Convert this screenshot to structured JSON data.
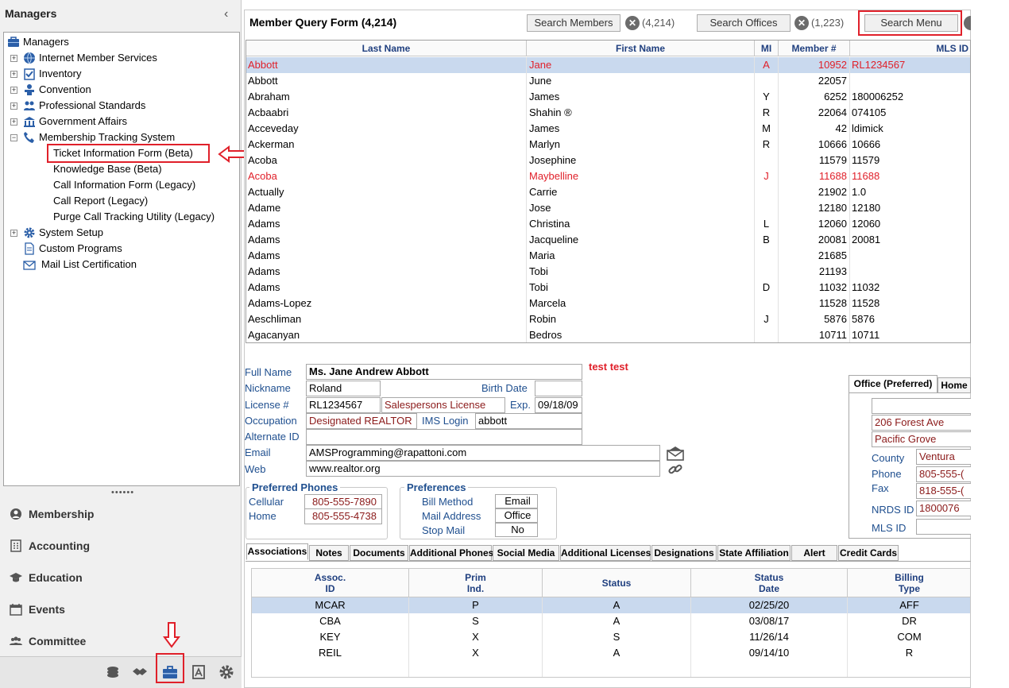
{
  "sidebar": {
    "title": "Managers",
    "tree": [
      {
        "label": "Managers",
        "icon": "briefcase-icon"
      },
      {
        "label": "Internet Member Services",
        "icon": "globe-icon"
      },
      {
        "label": "Inventory",
        "icon": "checklist-icon"
      },
      {
        "label": "Convention",
        "icon": "podium-icon"
      },
      {
        "label": "Professional Standards",
        "icon": "people-icon"
      },
      {
        "label": "Government Affairs",
        "icon": "building-icon"
      },
      {
        "label": "Membership Tracking System",
        "icon": "phone-icon"
      },
      {
        "label": "Ticket Information Form (Beta)"
      },
      {
        "label": "Knowledge Base (Beta)"
      },
      {
        "label": "Call Information Form (Legacy)"
      },
      {
        "label": "Call Report (Legacy)"
      },
      {
        "label": "Purge Call Tracking Utility (Legacy)"
      },
      {
        "label": "System Setup",
        "icon": "gear-icon"
      },
      {
        "label": "Custom Programs",
        "icon": "document-icon"
      },
      {
        "label": "Mail List Certification",
        "icon": "envelope-icon"
      }
    ],
    "nav_sections": [
      {
        "label": "Membership",
        "icon": "membership-icon"
      },
      {
        "label": "Accounting",
        "icon": "calculator-icon"
      },
      {
        "label": "Education",
        "icon": "graduation-cap-icon"
      },
      {
        "label": "Events",
        "icon": "calendar-icon"
      },
      {
        "label": "Committee",
        "icon": "group-icon"
      }
    ]
  },
  "header": {
    "form_title": "Member Query Form (4,214)",
    "search_members_label": "Search Members",
    "members_count": "(4,214)",
    "search_offices_label": "Search Offices",
    "offices_count": "(1,223)",
    "search_menu_label": "Search Menu"
  },
  "grid": {
    "columns": [
      "Last Name",
      "First Name",
      "MI",
      "Member #",
      "MLS ID"
    ],
    "rows": [
      [
        "Abbott",
        "Jane",
        "A",
        "10952",
        "RL1234567"
      ],
      [
        "Abbott",
        "June",
        "",
        "22057",
        ""
      ],
      [
        "Abraham",
        "James",
        "Y",
        "6252",
        "180006252"
      ],
      [
        "Acbaabri",
        "Shahin ®",
        "R",
        "22064",
        "074105"
      ],
      [
        "Acceveday",
        "James",
        "M",
        "42",
        "ldimick"
      ],
      [
        "Ackerman",
        "Marlyn",
        "R",
        "10666",
        "10666"
      ],
      [
        "Acoba",
        "Josephine",
        "",
        "11579",
        "11579"
      ],
      [
        "Acoba",
        "Maybelline",
        "J",
        "11688",
        "11688"
      ],
      [
        "Actually",
        "Carrie",
        "",
        "21902",
        "1.0"
      ],
      [
        "Adame",
        "Jose",
        "",
        "12180",
        "12180"
      ],
      [
        "Adams",
        "Christina",
        "L",
        "12060",
        "12060"
      ],
      [
        "Adams",
        "Jacqueline",
        "B",
        "20081",
        "20081"
      ],
      [
        "Adams",
        "Maria",
        "",
        "21685",
        ""
      ],
      [
        "Adams",
        "Tobi",
        "",
        "21193",
        ""
      ],
      [
        "Adams",
        "Tobi",
        "D",
        "11032",
        "11032"
      ],
      [
        "Adams-Lopez",
        "Marcela",
        "",
        "11528",
        "11528"
      ],
      [
        "Aeschliman",
        "Robin",
        "J",
        "5876",
        "5876"
      ],
      [
        "Agacanyan",
        "Bedros",
        "",
        "10711",
        "10711"
      ]
    ]
  },
  "detail": {
    "full_name_label": "Full Name",
    "full_name": "Ms. Jane Andrew  Abbott",
    "note": "test test",
    "nickname_label": "Nickname",
    "nickname": "Roland",
    "birth_date_label": "Birth Date",
    "birth_date": "",
    "license_label": "License #",
    "license": "RL1234567",
    "license_type": "Salespersons License",
    "exp_label": "Exp.",
    "exp": "09/18/09",
    "occupation_label": "Occupation",
    "occupation": "Designated REALTOR",
    "ims_login_label": "IMS Login",
    "ims_login": "abbott",
    "alternate_id_label": "Alternate ID",
    "alternate_id": "",
    "email_label": "Email",
    "email": "AMSProgramming@rapattoni.com",
    "web_label": "Web",
    "web": "www.realtor.org",
    "phones_title": "Preferred Phones",
    "cellular_label": "Cellular",
    "cellular": "805-555-7890",
    "home_label": "Home",
    "home": "805-555-4738",
    "prefs_title": "Preferences",
    "bill_method_label": "Bill Method",
    "bill_method": "Email",
    "mail_address_label": "Mail Address",
    "mail_address": "Office",
    "stop_mail_label": "Stop Mail",
    "stop_mail": "No"
  },
  "office": {
    "tab_preferred": "Office (Preferred)",
    "tab_home": "Home",
    "line1": "",
    "address": "206 Forest Ave",
    "city": "Pacific Grove",
    "county_label": "County",
    "county": "Ventura",
    "phone_label": "Phone",
    "phone": "805-555-(",
    "fax_label": "Fax",
    "fax": "818-555-(",
    "nrds_label": "NRDS ID",
    "nrds": "1800076",
    "mls_label": "MLS ID",
    "mls": ""
  },
  "tabs": [
    "Associations",
    "Notes",
    "Documents",
    "Additional Phones",
    "Social Media",
    "Additional Licenses",
    "Designations",
    "State Affiliation",
    "Alert",
    "Credit Cards"
  ],
  "assoc": {
    "headers": [
      "Assoc.\nID",
      "Prim\nInd.",
      "Status",
      "Status\nDate",
      "Billing\nType"
    ],
    "rows": [
      [
        "MCAR",
        "P",
        "A",
        "02/25/20",
        "AFF"
      ],
      [
        "CBA",
        "S",
        "A",
        "03/08/17",
        "DR"
      ],
      [
        "KEY",
        "X",
        "S",
        "11/26/14",
        "COM"
      ],
      [
        "REIL",
        "X",
        "A",
        "09/14/10",
        "R"
      ]
    ]
  },
  "bottom_icons": [
    "coins-icon",
    "handshake-icon",
    "briefcase-icon",
    "contacts-icon",
    "settings-gear-icon"
  ],
  "colors": {
    "highlight_red": "#e0202a",
    "selection_blue": "#c9d9ee",
    "label_blue": "#1f4f8f",
    "field_darkred": "#8b1a1a"
  }
}
